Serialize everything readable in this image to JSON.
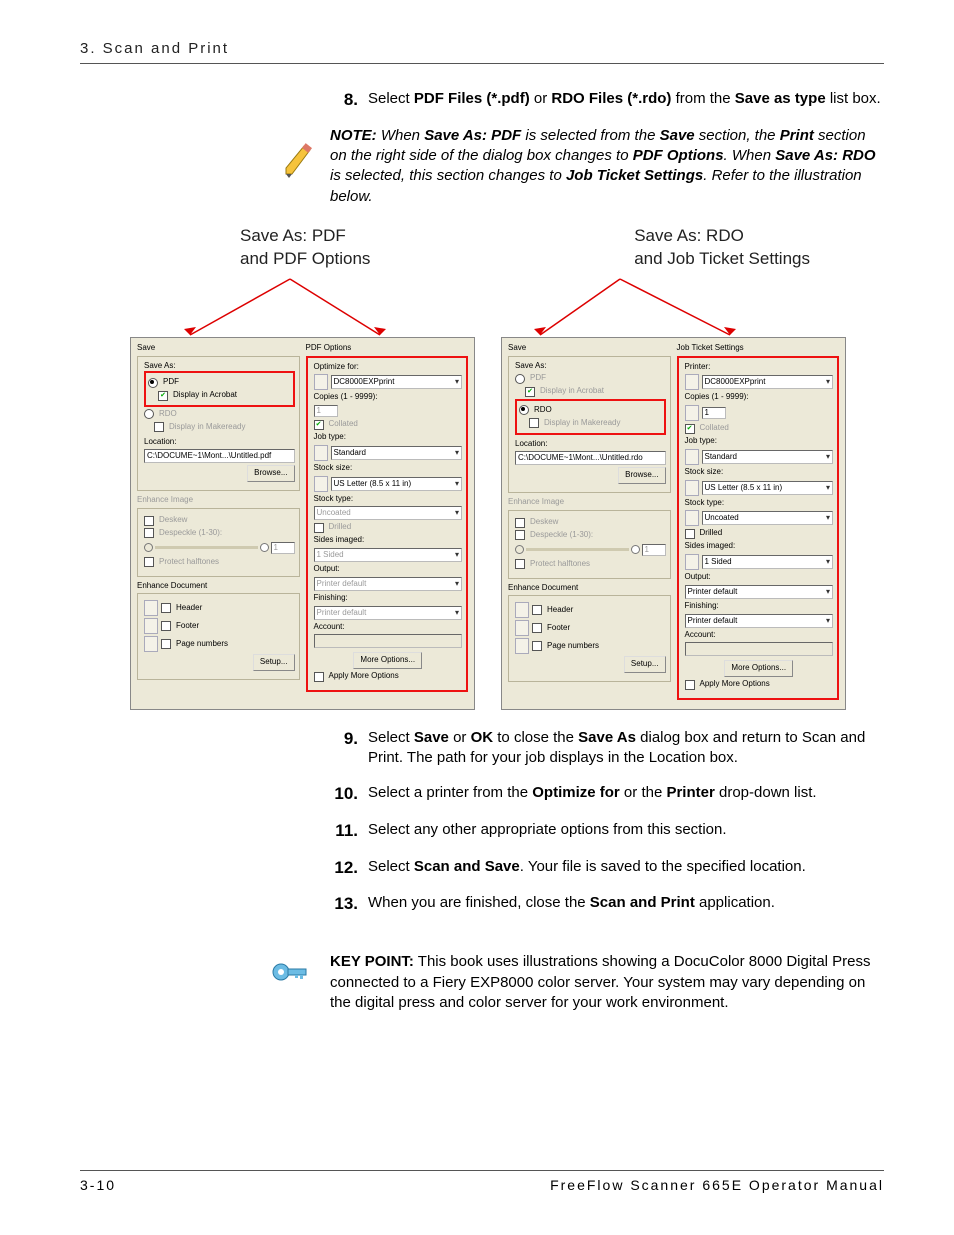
{
  "header": "3. Scan and Print",
  "steps": {
    "s8_num": "8.",
    "s8_a": "Select ",
    "s8_b1": "PDF Files (*.pdf)",
    "s8_mid": " or ",
    "s8_b2": "RDO Files (*.rdo)",
    "s8_c": " from the ",
    "s8_b3": "Save as type",
    "s8_d": " list box.",
    "s9_num": "9.",
    "s9_a": "Select ",
    "s9_b1": "Save",
    "s9_mid": " or ",
    "s9_b2": "OK",
    "s9_c": " to close the ",
    "s9_b3": "Save As",
    "s9_d": " dialog box and return to Scan and Print.  The path for your job displays in the Location box.",
    "s10_num": "10.",
    "s10_a": "Select a printer from the ",
    "s10_b1": "Optimize for",
    "s10_mid": " or the ",
    "s10_b2": "Printer",
    "s10_c": " drop-down list.",
    "s11_num": "11.",
    "s11_a": "Select any other appropriate options from this section.",
    "s12_num": "12.",
    "s12_a": "Select ",
    "s12_b1": "Scan and Save",
    "s12_c": ".  Your file is saved to the specified location.",
    "s13_num": "13.",
    "s13_a": "When you are finished, close the ",
    "s13_b1": "Scan and Print",
    "s13_c": " application."
  },
  "note": {
    "label": "NOTE:",
    "t1": "  When ",
    "b1": "Save As: PDF",
    "t2": " is selected from the ",
    "b2": "Save",
    "t3": " section, the ",
    "b3": "Print",
    "t4": " section on the right side of the dialog box changes to ",
    "b4": "PDF Options",
    "t5": ".  When ",
    "b5": "Save As: RDO",
    "t6": " is selected, this section changes to ",
    "b6": "Job Ticket Settings",
    "t7": ".  Refer to the illustration below."
  },
  "illus": {
    "label_left_1": "Save As: PDF",
    "label_left_2": "and PDF Options",
    "label_right_1": "Save As: RDO",
    "label_right_2": "and Job Ticket Settings"
  },
  "panel": {
    "save": "Save",
    "save_as": "Save As:",
    "pdf": "PDF",
    "rdo": "RDO",
    "disp_acrobat": "Display in Acrobat",
    "disp_mr": "Display in Makeready",
    "location": "Location:",
    "path_pdf": "C:\\DOCUME~1\\Mont...\\Untitled.pdf",
    "path_rdo": "C:\\DOCUME~1\\Mont...\\Untitled.rdo",
    "browse": "Browse...",
    "enh_image": "Enhance Image",
    "deskew": "Deskew",
    "despeckle": "Despeckle (1-30):",
    "protect": "Protect halftones",
    "enh_doc": "Enhance Document",
    "header": "Header",
    "footer": "Footer",
    "pagenums": "Page numbers",
    "setup": "Setup...",
    "pdf_options": "PDF Options",
    "optimize_for": "Optimize for:",
    "printer": "Printer:",
    "printer_val": "DC8000EXPprint",
    "copies": "Copies (1 - 9999):",
    "copies_val": "1",
    "collated": "Collated",
    "job_type": "Job type:",
    "standard": "Standard",
    "stock_size": "Stock size:",
    "stock_size_val": "US Letter (8.5 x 11 in)",
    "stock_type": "Stock type:",
    "uncoated": "Uncoated",
    "drilled": "Drilled",
    "sides_imaged": "Sides imaged:",
    "one_sided": "1 Sided",
    "output": "Output:",
    "printer_default": "Printer default",
    "finishing": "Finishing:",
    "account": "Account:",
    "more_options": "More Options...",
    "apply_more": "Apply More Options",
    "jts": "Job Ticket Settings"
  },
  "keypoint": {
    "label": "KEY POINT:",
    "text": " This book uses illustrations showing a DocuColor 8000 Digital Press connected to a Fiery EXP8000 color server.  Your system may vary depending on the digital press and color server for your work environment."
  },
  "footer": {
    "left": "3-10",
    "right": "FreeFlow Scanner 665E Operator Manual"
  }
}
